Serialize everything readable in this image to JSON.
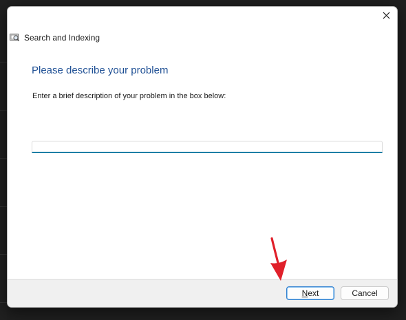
{
  "window": {
    "title": "Search and Indexing",
    "icon": "search-indexing-icon",
    "close_glyph": "✕"
  },
  "page": {
    "heading": "Please describe your problem",
    "instruction": "Enter a brief description of your problem in the box below:",
    "input_value": "",
    "input_placeholder": ""
  },
  "footer": {
    "next_accel": "N",
    "next_rest": "ext",
    "cancel_label": "Cancel"
  },
  "colors": {
    "heading": "#1e4f94",
    "input_focus": "#1d7fa6",
    "annotation_arrow": "#e0202a",
    "footer_bg": "#f0f0f0"
  }
}
